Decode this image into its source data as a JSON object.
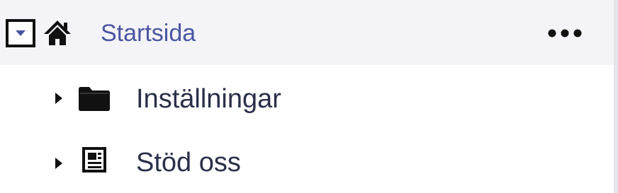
{
  "tree": {
    "root": {
      "label": "Startsida",
      "expanded": true,
      "icon": "home-icon",
      "toggle_icon": "caret-down-icon",
      "more_icon": "more-horizontal-icon",
      "label_color": "#4a55a2",
      "background": "#f4f4f8"
    },
    "children": [
      {
        "label": "Inställningar",
        "icon": "folder-icon",
        "toggle_icon": "caret-right-icon",
        "expanded": false
      },
      {
        "label": "Stöd oss",
        "icon": "newspaper-icon",
        "toggle_icon": "caret-right-icon",
        "expanded": false
      }
    ],
    "accent_color": "#4a55a2",
    "text_color": "#2b2f4a"
  }
}
